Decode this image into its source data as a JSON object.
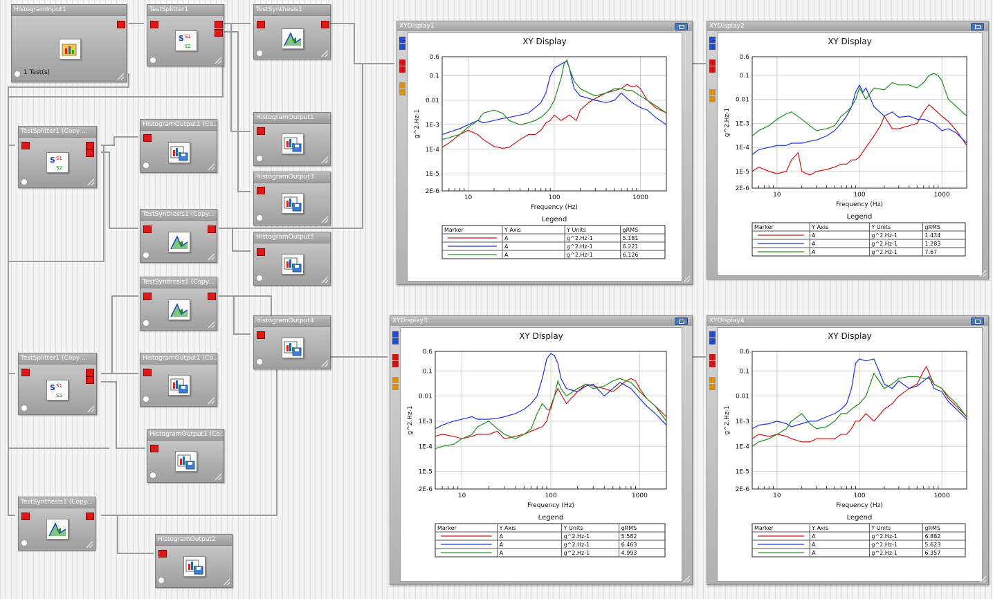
{
  "nodes": {
    "histogram_input": {
      "title": "HistogramInput1",
      "subtext": "1 Test(s)"
    },
    "test_splitter_1": {
      "title": "TestSplitter1"
    },
    "test_synthesis_1": {
      "title": "TestSynthesis1"
    },
    "test_splitter_copy_a": {
      "title": "TestSplitter1 (Copy ..."
    },
    "histogram_output_1_copy_a": {
      "title": "HistogramOutput1 (Co..."
    },
    "histogram_output_1": {
      "title": "HistogramOutput1"
    },
    "histogram_output_3": {
      "title": "HistogramOutput3"
    },
    "test_synthesis_copy_a": {
      "title": "TestSynthesis1 (Copy..."
    },
    "histogram_output_5": {
      "title": "HistogramOutput5"
    },
    "test_synthesis_copy_b": {
      "title": "TestSynthesis1 (Copy..."
    },
    "histogram_output_4": {
      "title": "HistogramOutput4"
    },
    "test_splitter_copy_b": {
      "title": "TestSplitter1 (Copy ..."
    },
    "histogram_output_1_copy_b": {
      "title": "HistogramOutput1 (Co..."
    },
    "histogram_output_1_copy_c": {
      "title": "HistogramOutput1 (Co..."
    },
    "test_synthesis_copy_c": {
      "title": "TestSynthesis1 (Copy..."
    },
    "histogram_output_2": {
      "title": "HistogramOutput2"
    }
  },
  "icons": {
    "input": "folder-chart-icon",
    "splitter": "splitter-s1-s2-icon",
    "synthesis": "synthesis-chart-icon",
    "output": "histogram-output-icon"
  },
  "colors": {
    "red": "#d41212",
    "blue": "#1b2ee8",
    "green": "#1a8f1a",
    "port_red": "#e01818",
    "port_blue": "#1e4fd0",
    "port_orange": "#d89012"
  },
  "legend_headers": {
    "marker": "Marker",
    "y_axis": "Y Axis",
    "y_units": "Y Units",
    "grms": "gRMS"
  },
  "chart_data": [
    {
      "window_title": "XYDisplay1",
      "type": "line",
      "title": "XY Display",
      "xlabel": "Frequency (Hz)",
      "ylabel": "g^2.Hz-1",
      "xscale": "log",
      "yscale": "log",
      "xlim": [
        5,
        2000
      ],
      "ylim": [
        2e-06,
        0.6
      ],
      "xticks": [
        "10",
        "100",
        "1000"
      ],
      "yticks": [
        "0.6",
        "0.1",
        "0.01",
        "1E-3",
        "1E-4",
        "1E-5",
        "2E-6"
      ],
      "legend_title": "Legend",
      "series": [
        {
          "color": "red",
          "y_axis": "A",
          "y_units": "g^2.Hz-1",
          "grms": "5.181",
          "x": [
            5,
            6,
            8,
            10,
            13,
            15,
            20,
            25,
            30,
            40,
            50,
            60,
            70,
            80,
            90,
            100,
            120,
            150,
            180,
            200,
            250,
            300,
            400,
            500,
            600,
            700,
            800,
            900,
            1000,
            1200,
            1500,
            2000
          ],
          "y": [
            0.00012,
            0.00018,
            0.0004,
            0.0006,
            0.0004,
            0.00025,
            0.00013,
            0.00011,
            0.00012,
            0.00025,
            0.0004,
            0.0004,
            0.0006,
            0.0012,
            0.0015,
            0.0025,
            0.0015,
            0.0025,
            0.0015,
            0.004,
            0.008,
            0.012,
            0.02,
            0.025,
            0.03,
            0.045,
            0.035,
            0.04,
            0.03,
            0.01,
            0.005,
            0.003
          ]
        },
        {
          "color": "blue",
          "y_axis": "A",
          "y_units": "g^2.Hz-1",
          "grms": "6.221",
          "x": [
            5,
            6,
            8,
            10,
            13,
            15,
            20,
            25,
            30,
            40,
            50,
            60,
            70,
            80,
            90,
            100,
            110,
            120,
            130,
            140,
            150,
            170,
            200,
            250,
            300,
            400,
            500,
            600,
            700,
            800,
            1000,
            1200,
            1500,
            2000
          ],
          "y": [
            0.0004,
            0.0005,
            0.0007,
            0.001,
            0.0015,
            0.0012,
            0.0015,
            0.0018,
            0.002,
            0.0025,
            0.003,
            0.005,
            0.008,
            0.02,
            0.1,
            0.2,
            0.25,
            0.3,
            0.35,
            0.4,
            0.2,
            0.03,
            0.015,
            0.012,
            0.01,
            0.008,
            0.01,
            0.02,
            0.012,
            0.008,
            0.005,
            0.004,
            0.002,
            0.001
          ]
        },
        {
          "color": "green",
          "y_axis": "A",
          "y_units": "g^2.Hz-1",
          "grms": "6.126",
          "x": [
            5,
            6,
            8,
            10,
            13,
            15,
            20,
            25,
            30,
            40,
            50,
            60,
            70,
            80,
            90,
            100,
            110,
            120,
            130,
            140,
            150,
            170,
            200,
            250,
            300,
            400,
            500,
            600,
            700,
            800,
            1000,
            1200,
            1500,
            2000
          ],
          "y": [
            0.00025,
            0.0003,
            0.0004,
            0.0008,
            0.0015,
            0.003,
            0.004,
            0.003,
            0.0015,
            0.001,
            0.0012,
            0.0015,
            0.002,
            0.003,
            0.005,
            0.01,
            0.03,
            0.08,
            0.3,
            0.45,
            0.2,
            0.06,
            0.03,
            0.02,
            0.015,
            0.02,
            0.03,
            0.03,
            0.025,
            0.025,
            0.015,
            0.01,
            0.006,
            0.003
          ]
        }
      ]
    },
    {
      "window_title": "XYDisplay2",
      "type": "line",
      "title": "XY Display",
      "xlabel": "Frequency (Hz)",
      "ylabel": "g^2.Hz-1",
      "xscale": "log",
      "yscale": "log",
      "xlim": [
        5,
        2000
      ],
      "ylim": [
        2e-06,
        0.6
      ],
      "xticks": [
        "10",
        "100",
        "1000"
      ],
      "yticks": [
        "0.6",
        "0.1",
        "0.01",
        "1E-3",
        "1E-4",
        "1E-5",
        "2E-6"
      ],
      "legend_title": "Legend",
      "series": [
        {
          "color": "red",
          "y_axis": "A",
          "y_units": "g^2.Hz-1",
          "grms": "1.434",
          "x": [
            5,
            6,
            8,
            10,
            13,
            15,
            18,
            20,
            25,
            30,
            40,
            50,
            60,
            70,
            80,
            90,
            100,
            120,
            150,
            180,
            200,
            250,
            300,
            400,
            500,
            600,
            700,
            800,
            1000,
            1200,
            1500,
            2000
          ],
          "y": [
            1e-05,
            1.5e-05,
            1e-05,
            8e-06,
            1e-05,
            3e-05,
            6e-05,
            1e-05,
            7e-06,
            1e-05,
            1.2e-05,
            1.5e-05,
            2e-05,
            2e-05,
            3e-05,
            3e-05,
            4e-05,
            0.0001,
            0.0003,
            0.0008,
            0.002,
            0.0006,
            0.0006,
            0.0008,
            0.001,
            0.003,
            0.006,
            0.004,
            0.002,
            0.0012,
            0.0005,
            0.00012
          ]
        },
        {
          "color": "blue",
          "y_axis": "A",
          "y_units": "g^2.Hz-1",
          "grms": "1.283",
          "x": [
            5,
            6,
            8,
            10,
            13,
            15,
            20,
            25,
            30,
            40,
            50,
            60,
            70,
            80,
            90,
            100,
            110,
            120,
            150,
            200,
            250,
            300,
            400,
            500,
            600,
            800,
            1000,
            1200,
            1500,
            2000
          ],
          "y": [
            5e-05,
            8e-05,
            0.0001,
            0.00012,
            0.00012,
            0.00015,
            0.00015,
            0.00018,
            0.0002,
            0.0003,
            0.0005,
            0.001,
            0.002,
            0.005,
            0.02,
            0.04,
            0.02,
            0.03,
            0.005,
            0.002,
            0.003,
            0.0018,
            0.002,
            0.0015,
            0.0015,
            0.001,
            0.0005,
            0.0006,
            0.0004,
            0.00015
          ]
        },
        {
          "color": "green",
          "y_axis": "A",
          "y_units": "g^2.Hz-1",
          "grms": "7.67",
          "x": [
            5,
            6,
            8,
            10,
            13,
            15,
            20,
            25,
            30,
            40,
            50,
            60,
            70,
            80,
            90,
            100,
            120,
            150,
            200,
            250,
            300,
            400,
            500,
            600,
            700,
            800,
            900,
            1000,
            1200,
            1500,
            2000
          ],
          "y": [
            0.0003,
            0.0005,
            0.0008,
            0.0015,
            0.0025,
            0.003,
            0.0015,
            0.0008,
            0.0005,
            0.0006,
            0.0008,
            0.002,
            0.003,
            0.005,
            0.01,
            0.03,
            0.01,
            0.03,
            0.025,
            0.05,
            0.04,
            0.04,
            0.03,
            0.05,
            0.1,
            0.12,
            0.1,
            0.06,
            0.01,
            0.005,
            0.002
          ]
        }
      ]
    },
    {
      "window_title": "XYDisplay3",
      "type": "line",
      "title": "XY Display",
      "xlabel": "Frequency (Hz)",
      "ylabel": "g^2.Hz-1",
      "xscale": "log",
      "yscale": "log",
      "xlim": [
        5,
        2000
      ],
      "ylim": [
        2e-06,
        0.6
      ],
      "xticks": [
        "10",
        "100",
        "1000"
      ],
      "yticks": [
        "0.6",
        "0.1",
        "0.01",
        "1E-3",
        "1E-4",
        "1E-5",
        "2E-6"
      ],
      "legend_title": "Legend",
      "series": [
        {
          "color": "red",
          "y_axis": "A",
          "y_units": "g^2.Hz-1",
          "grms": "5.582",
          "x": [
            5,
            6,
            8,
            10,
            13,
            15,
            20,
            25,
            30,
            40,
            50,
            60,
            70,
            80,
            90,
            100,
            110,
            120,
            150,
            200,
            250,
            300,
            400,
            500,
            600,
            700,
            800,
            900,
            1000,
            1200,
            1500,
            2000
          ],
          "y": [
            0.00025,
            0.0003,
            0.00025,
            0.0002,
            0.00025,
            0.0003,
            0.0003,
            0.0004,
            0.0002,
            0.00025,
            0.0003,
            0.0004,
            0.0005,
            0.0006,
            0.001,
            0.004,
            0.01,
            0.02,
            0.005,
            0.015,
            0.03,
            0.025,
            0.02,
            0.015,
            0.025,
            0.04,
            0.05,
            0.04,
            0.02,
            0.008,
            0.004,
            0.0015
          ]
        },
        {
          "color": "blue",
          "y_axis": "A",
          "y_units": "g^2.Hz-1",
          "grms": "6.463",
          "x": [
            5,
            6,
            8,
            10,
            13,
            15,
            20,
            25,
            30,
            40,
            50,
            60,
            70,
            80,
            90,
            100,
            110,
            120,
            130,
            150,
            200,
            250,
            300,
            400,
            500,
            600,
            800,
            1000,
            1200,
            1500,
            2000
          ],
          "y": [
            0.0005,
            0.0007,
            0.001,
            0.0012,
            0.0015,
            0.0012,
            0.0012,
            0.0013,
            0.0015,
            0.002,
            0.003,
            0.005,
            0.01,
            0.05,
            0.3,
            0.5,
            0.4,
            0.2,
            0.05,
            0.02,
            0.015,
            0.025,
            0.03,
            0.01,
            0.02,
            0.035,
            0.02,
            0.008,
            0.004,
            0.002,
            0.0007
          ]
        },
        {
          "color": "green",
          "y_axis": "A",
          "y_units": "g^2.Hz-1",
          "grms": "4.993",
          "x": [
            5,
            6,
            8,
            10,
            13,
            15,
            20,
            25,
            30,
            40,
            50,
            60,
            70,
            80,
            90,
            100,
            110,
            120,
            130,
            150,
            200,
            250,
            300,
            400,
            500,
            600,
            700,
            800,
            1000,
            1200,
            1500,
            2000
          ],
          "y": [
            8e-05,
            0.0001,
            0.00012,
            0.0002,
            0.0003,
            0.0006,
            0.001,
            0.0005,
            0.0003,
            0.0002,
            0.0003,
            0.0005,
            0.002,
            0.005,
            0.003,
            0.003,
            0.01,
            0.04,
            0.02,
            0.01,
            0.02,
            0.03,
            0.02,
            0.025,
            0.04,
            0.05,
            0.04,
            0.035,
            0.015,
            0.008,
            0.004,
            0.001
          ]
        }
      ]
    },
    {
      "window_title": "XYDisplay4",
      "type": "line",
      "title": "XY Display",
      "xlabel": "Frequency (Hz)",
      "ylabel": "g^2.Hz-1",
      "xscale": "log",
      "yscale": "log",
      "xlim": [
        5,
        2000
      ],
      "ylim": [
        2e-06,
        0.6
      ],
      "xticks": [
        "10",
        "100",
        "1000"
      ],
      "yticks": [
        "0.6",
        "0.1",
        "0.01",
        "1E-3",
        "1E-4",
        "1E-5",
        "2E-6"
      ],
      "legend_title": "Legend",
      "series": [
        {
          "color": "red",
          "y_axis": "A",
          "y_units": "g^2.Hz-1",
          "grms": "6.882",
          "x": [
            5,
            6,
            8,
            10,
            13,
            15,
            20,
            25,
            30,
            40,
            50,
            60,
            70,
            80,
            90,
            100,
            120,
            150,
            200,
            250,
            300,
            400,
            500,
            600,
            650,
            700,
            800,
            1000,
            1200,
            1500,
            2000
          ],
          "y": [
            0.0002,
            0.0003,
            0.00025,
            0.0003,
            0.00025,
            0.0002,
            0.00015,
            0.00015,
            0.0002,
            0.0002,
            0.0002,
            0.0003,
            0.0003,
            0.0005,
            0.001,
            0.001,
            0.002,
            0.001,
            0.003,
            0.005,
            0.01,
            0.02,
            0.03,
            0.1,
            0.15,
            0.08,
            0.03,
            0.02,
            0.008,
            0.004,
            0.0015
          ]
        },
        {
          "color": "blue",
          "y_axis": "A",
          "y_units": "g^2.Hz-1",
          "grms": "5.623",
          "x": [
            5,
            6,
            8,
            10,
            13,
            15,
            20,
            25,
            30,
            40,
            50,
            60,
            70,
            80,
            90,
            100,
            120,
            150,
            200,
            250,
            300,
            400,
            500,
            600,
            700,
            800,
            1000,
            1200,
            1500,
            2000
          ],
          "y": [
            0.0005,
            0.0007,
            0.0008,
            0.001,
            0.0008,
            0.0006,
            0.0008,
            0.001,
            0.001,
            0.0015,
            0.002,
            0.003,
            0.005,
            0.02,
            0.2,
            0.3,
            0.25,
            0.3,
            0.03,
            0.02,
            0.04,
            0.02,
            0.025,
            0.04,
            0.06,
            0.02,
            0.015,
            0.006,
            0.003,
            0.0012
          ]
        },
        {
          "color": "green",
          "y_axis": "A",
          "y_units": "g^2.Hz-1",
          "grms": "6.357",
          "x": [
            5,
            6,
            8,
            10,
            13,
            15,
            20,
            25,
            30,
            40,
            50,
            60,
            70,
            80,
            90,
            100,
            120,
            150,
            200,
            250,
            300,
            400,
            500,
            600,
            700,
            800,
            1000,
            1200,
            1500,
            2000
          ],
          "y": [
            0.0001,
            0.00015,
            0.0002,
            0.0003,
            0.0005,
            0.001,
            0.002,
            0.0008,
            0.0005,
            0.0006,
            0.001,
            0.002,
            0.002,
            0.003,
            0.004,
            0.005,
            0.01,
            0.08,
            0.02,
            0.03,
            0.05,
            0.06,
            0.06,
            0.05,
            0.05,
            0.03,
            0.02,
            0.01,
            0.005,
            0.0015
          ]
        }
      ]
    }
  ]
}
